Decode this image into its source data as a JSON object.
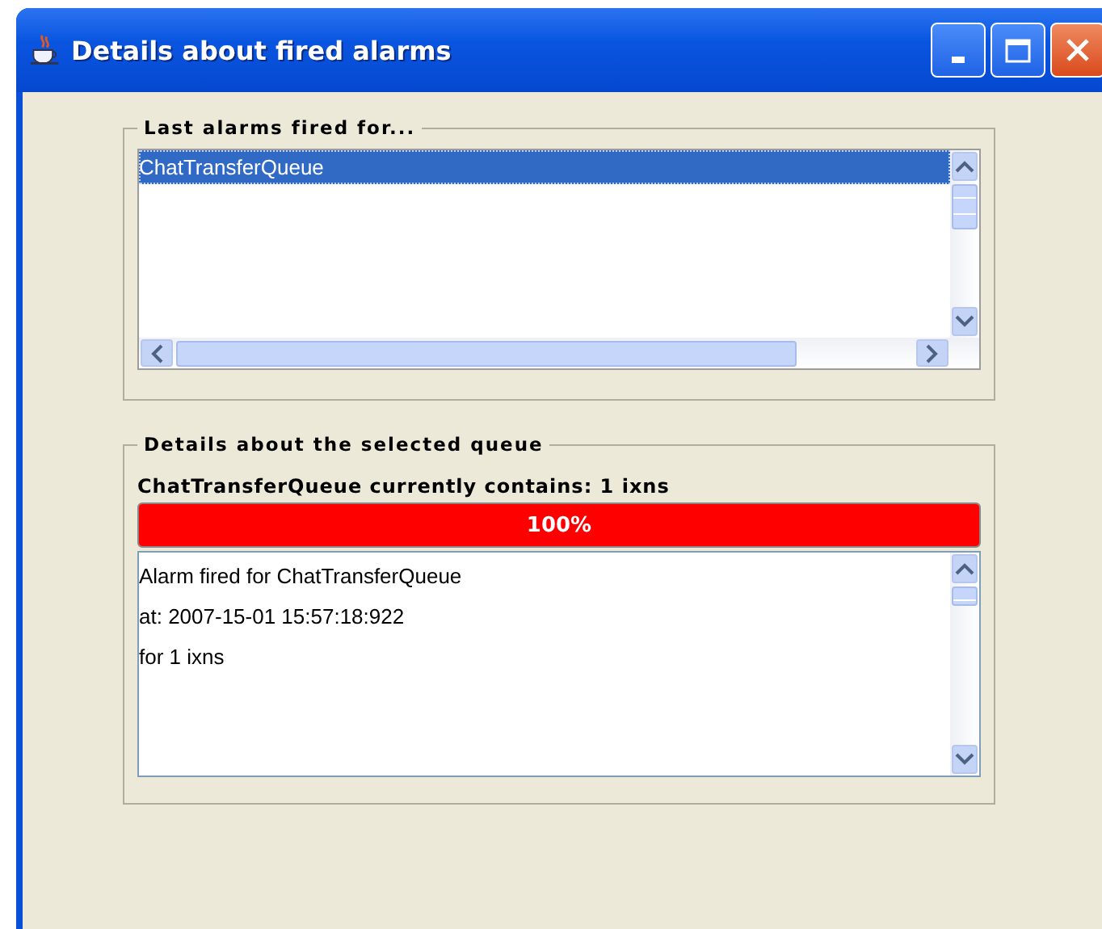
{
  "window": {
    "title": "Details about fired alarms",
    "buttons": [
      {
        "kind": "minimize"
      },
      {
        "kind": "maximize"
      },
      {
        "kind": "close"
      }
    ]
  },
  "alarms_group": {
    "title": "Last alarms fired for...",
    "items": [
      {
        "label": "ChatTransferQueue",
        "selected": true
      }
    ]
  },
  "details_group": {
    "title": "Details about the selected queue",
    "summary": "ChatTransferQueue currently contains: 1 ixns",
    "progress": {
      "level": 1,
      "text": "100%"
    },
    "log": [
      "Alarm fired for ChatTransferQueue",
      "at: 2007-15-01 15:57:18:922",
      "for 1 ixns"
    ]
  }
}
